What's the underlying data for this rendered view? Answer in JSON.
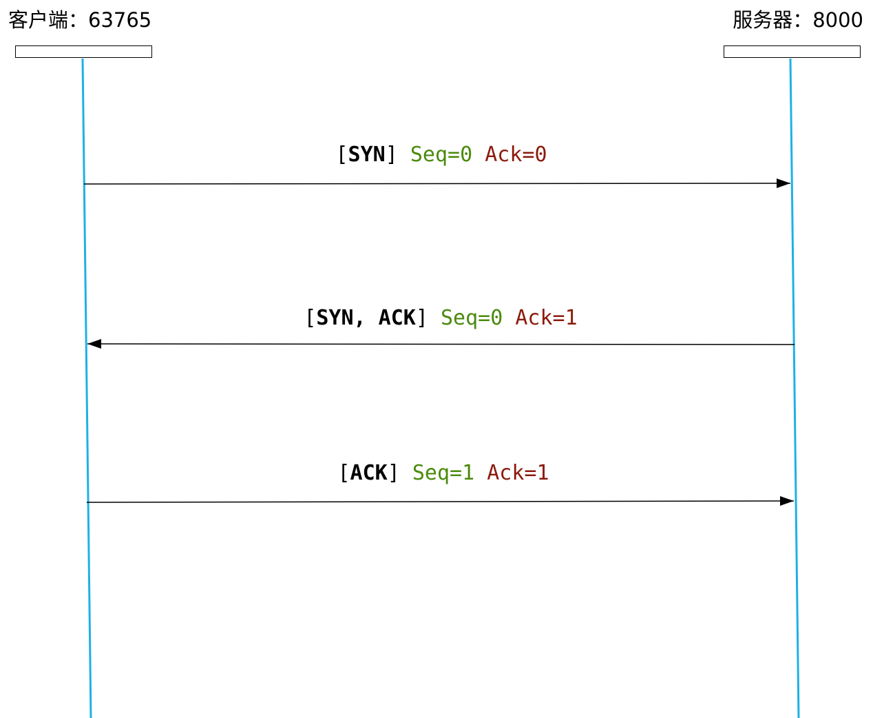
{
  "client": {
    "title": "客户端：63765"
  },
  "server": {
    "title": "服务器：8000"
  },
  "colors": {
    "lifeline": "#1fb0e6",
    "arrow": "#000000",
    "seq": "#4a8a0c",
    "ack": "#8b1a0c"
  },
  "messages": [
    {
      "direction": "client-to-server",
      "open": "[",
      "flags": "SYN",
      "close": "]",
      "seq": "Seq=0",
      "ack": "Ack=0"
    },
    {
      "direction": "server-to-client",
      "open": "[",
      "flags": "SYN, ACK",
      "close": "]",
      "seq": "Seq=0",
      "ack": "Ack=1"
    },
    {
      "direction": "client-to-server",
      "open": "[",
      "flags": "ACK",
      "close": "]",
      "seq": "Seq=1",
      "ack": "Ack=1"
    }
  ]
}
